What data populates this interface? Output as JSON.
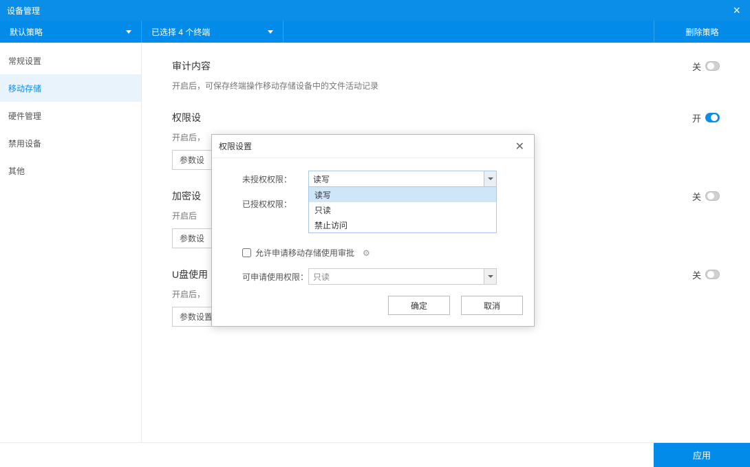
{
  "header": {
    "title": "设备管理"
  },
  "toolbar": {
    "policy": "默认策略",
    "selection": "已选择 4 个终端",
    "delete": "删除策略"
  },
  "sidebar": {
    "items": [
      {
        "label": "常规设置"
      },
      {
        "label": "移动存储"
      },
      {
        "label": "硬件管理"
      },
      {
        "label": "禁用设备"
      },
      {
        "label": "其他"
      }
    ]
  },
  "sections": {
    "audit": {
      "title": "审计内容",
      "desc": "开启后，可保存终端操作移动存储设备中的文件活动记录",
      "state": "关"
    },
    "perm": {
      "title": "权限设",
      "desc": "开启后，",
      "state": "开",
      "param": "参数设"
    },
    "encrypt": {
      "title": "加密设",
      "desc": "开启后",
      "state": "关",
      "param": "参数设"
    },
    "usb": {
      "title": "U盘使用",
      "desc": "开启后，",
      "state": "关",
      "param": "参数设置"
    }
  },
  "modal": {
    "title": "权限设置",
    "labels": {
      "unauth": "未授权权限：",
      "auth": "已授权权限：",
      "allow_apply": "允许申请移动存储使用审批",
      "apply_perm": "可申请使用权限："
    },
    "unauth_value": "读写",
    "options": [
      "读写",
      "只读",
      "禁止访问"
    ],
    "apply_value": "只读",
    "ok": "确定",
    "cancel": "取消"
  },
  "footer": {
    "apply": "应用"
  }
}
